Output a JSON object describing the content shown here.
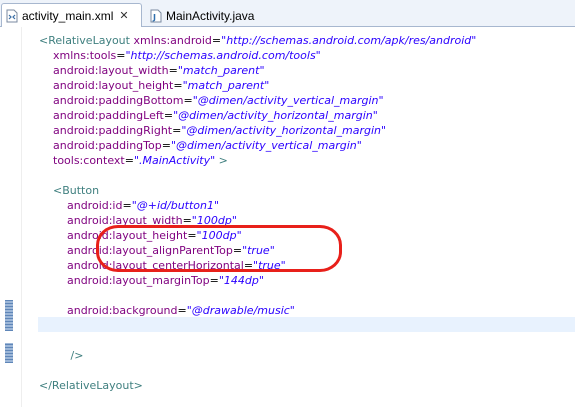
{
  "tabs": [
    {
      "label": "activity_main.xml",
      "close": "✕",
      "active": true,
      "icon": "xml-file-icon"
    },
    {
      "label": "MainActivity.java",
      "active": false,
      "icon": "java-file-icon"
    }
  ],
  "code": {
    "lines": [
      {
        "indent": "",
        "parts": [
          {
            "t": "tag",
            "v": "<RelativeLayout"
          },
          {
            "t": "plain",
            "v": " "
          },
          {
            "t": "attr",
            "v": "xmlns:android"
          },
          {
            "t": "eq",
            "v": "="
          },
          {
            "t": "val",
            "v": "\"http://schemas.android.com/apk/res/android\""
          }
        ]
      },
      {
        "indent": "    ",
        "parts": [
          {
            "t": "attr",
            "v": "xmlns:tools"
          },
          {
            "t": "eq",
            "v": "="
          },
          {
            "t": "val",
            "v": "\"http://schemas.android.com/tools\""
          }
        ]
      },
      {
        "indent": "    ",
        "parts": [
          {
            "t": "attr",
            "v": "android:layout_width"
          },
          {
            "t": "eq",
            "v": "="
          },
          {
            "t": "val",
            "v": "\"match_parent\""
          }
        ]
      },
      {
        "indent": "    ",
        "parts": [
          {
            "t": "attr",
            "v": "android:layout_height"
          },
          {
            "t": "eq",
            "v": "="
          },
          {
            "t": "val",
            "v": "\"match_parent\""
          }
        ]
      },
      {
        "indent": "    ",
        "parts": [
          {
            "t": "attr",
            "v": "android:paddingBottom"
          },
          {
            "t": "eq",
            "v": "="
          },
          {
            "t": "val",
            "v": "\"@dimen/activity_vertical_margin\""
          }
        ]
      },
      {
        "indent": "    ",
        "parts": [
          {
            "t": "attr",
            "v": "android:paddingLeft"
          },
          {
            "t": "eq",
            "v": "="
          },
          {
            "t": "val",
            "v": "\"@dimen/activity_horizontal_margin\""
          }
        ]
      },
      {
        "indent": "    ",
        "parts": [
          {
            "t": "attr",
            "v": "android:paddingRight"
          },
          {
            "t": "eq",
            "v": "="
          },
          {
            "t": "val",
            "v": "\"@dimen/activity_horizontal_margin\""
          }
        ]
      },
      {
        "indent": "    ",
        "parts": [
          {
            "t": "attr",
            "v": "android:paddingTop"
          },
          {
            "t": "eq",
            "v": "="
          },
          {
            "t": "val",
            "v": "\"@dimen/activity_vertical_margin\""
          }
        ]
      },
      {
        "indent": "    ",
        "parts": [
          {
            "t": "attr",
            "v": "tools:context"
          },
          {
            "t": "eq",
            "v": "="
          },
          {
            "t": "val",
            "v": "\".MainActivity\""
          },
          {
            "t": "plain",
            "v": " "
          },
          {
            "t": "tag",
            "v": ">"
          }
        ]
      },
      {
        "indent": "",
        "parts": []
      },
      {
        "indent": "    ",
        "parts": [
          {
            "t": "tag",
            "v": "<Button"
          }
        ]
      },
      {
        "indent": "        ",
        "parts": [
          {
            "t": "attr",
            "v": "android:id"
          },
          {
            "t": "eq",
            "v": "="
          },
          {
            "t": "val",
            "v": "\"@+id/button1\""
          }
        ]
      },
      {
        "indent": "        ",
        "parts": [
          {
            "t": "attr",
            "v": "android:layout_width"
          },
          {
            "t": "eq",
            "v": "="
          },
          {
            "t": "val",
            "v": "\"100dp\""
          }
        ]
      },
      {
        "indent": "        ",
        "parts": [
          {
            "t": "attr",
            "v": "android:layout_height"
          },
          {
            "t": "eq",
            "v": "="
          },
          {
            "t": "val",
            "v": "\"100dp\""
          }
        ]
      },
      {
        "indent": "        ",
        "parts": [
          {
            "t": "attr",
            "v": "android:layout_alignParentTop"
          },
          {
            "t": "eq",
            "v": "="
          },
          {
            "t": "val",
            "v": "\"true\""
          }
        ]
      },
      {
        "indent": "        ",
        "parts": [
          {
            "t": "attr",
            "v": "android:layout_centerHorizontal"
          },
          {
            "t": "eq",
            "v": "="
          },
          {
            "t": "val",
            "v": "\"true\""
          }
        ]
      },
      {
        "indent": "        ",
        "parts": [
          {
            "t": "attr",
            "v": "android:layout_marginTop"
          },
          {
            "t": "eq",
            "v": "="
          },
          {
            "t": "val",
            "v": "\"144dp\""
          }
        ]
      },
      {
        "indent": "",
        "parts": []
      },
      {
        "indent": "        ",
        "parts": [
          {
            "t": "attr",
            "v": "android:background"
          },
          {
            "t": "eq",
            "v": "="
          },
          {
            "t": "val",
            "v": "\"@drawable/music\""
          }
        ]
      },
      {
        "indent": "",
        "parts": []
      },
      {
        "indent": "",
        "parts": []
      },
      {
        "indent": "         ",
        "parts": [
          {
            "t": "tag",
            "v": "/>"
          }
        ]
      },
      {
        "indent": "",
        "parts": []
      },
      {
        "indent": "",
        "parts": [
          {
            "t": "tag",
            "v": "</RelativeLayout>"
          }
        ]
      }
    ]
  },
  "colors": {
    "tag": "#3f7f7f",
    "attribute": "#7f007f",
    "value": "#2a00ff",
    "annotation": "#e8201a",
    "current_line": "#e8f2fe"
  }
}
